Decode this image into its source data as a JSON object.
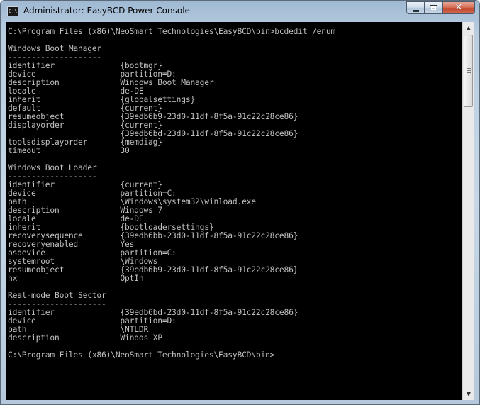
{
  "window": {
    "title": "Administrator:  EasyBCD Power Console",
    "icon_label": "C:\\"
  },
  "caption_buttons": {
    "minimize_icon": "minimize-icon",
    "maximize_icon": "maximize-icon",
    "close_icon": "close-icon",
    "close_glyph": "✕"
  },
  "console": {
    "lines": [
      "C:\\Program Files (x86)\\NeoSmart Technologies\\EasyBCD\\bin>bcdedit /enum",
      "",
      "Windows Boot Manager",
      "--------------------",
      "identifier              {bootmgr}",
      "device                  partition=D:",
      "description             Windows Boot Manager",
      "locale                  de-DE",
      "inherit                 {globalsettings}",
      "default                 {current}",
      "resumeobject            {39edb6b9-23d0-11df-8f5a-91c22c28ce86}",
      "displayorder            {current}",
      "                        {39edb6bd-23d0-11df-8f5a-91c22c28ce86}",
      "toolsdisplayorder       {memdiag}",
      "timeout                 30",
      "",
      "Windows Boot Loader",
      "-------------------",
      "identifier              {current}",
      "device                  partition=C:",
      "path                    \\Windows\\system32\\winload.exe",
      "description             Windows 7",
      "locale                  de-DE",
      "inherit                 {bootloadersettings}",
      "recoverysequence        {39edb6bb-23d0-11df-8f5a-91c22c28ce86}",
      "recoveryenabled         Yes",
      "osdevice                partition=C:",
      "systemroot              \\Windows",
      "resumeobject            {39edb6b9-23d0-11df-8f5a-91c22c28ce86}",
      "nx                      OptIn",
      "",
      "Real-mode Boot Sector",
      "---------------------",
      "identifier              {39edb6bd-23d0-11df-8f5a-91c22c28ce86}",
      "device                  partition=D:",
      "path                    \\NTLDR",
      "description             Windos XP",
      "",
      "C:\\Program Files (x86)\\NeoSmart Technologies\\EasyBCD\\bin>"
    ]
  },
  "scrollbar": {
    "up_arrow": "▲",
    "down_arrow": "▼",
    "position_fraction": 0.0
  },
  "colors": {
    "console_background": "#000000",
    "console_text": "#c0c0c0",
    "close_button": "#c2472d"
  }
}
